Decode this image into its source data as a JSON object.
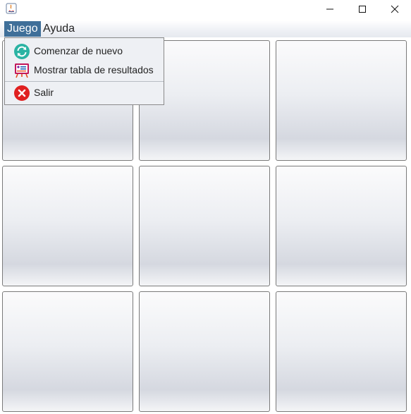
{
  "menubar": {
    "juego": "Juego",
    "ayuda": "Ayuda"
  },
  "juego_menu": {
    "items": [
      {
        "label": "Comenzar de nuevo",
        "icon": "refresh-icon"
      },
      {
        "label": "Mostrar tabla de resultados",
        "icon": "scoreboard-icon"
      },
      {
        "label": "Salir",
        "icon": "exit-icon"
      }
    ]
  },
  "board": {
    "rows": 3,
    "cols": 3
  },
  "colors": {
    "menu_active": "#3f6f99",
    "exit_red": "#e02020",
    "refresh_teal": "#2bb3a3"
  }
}
